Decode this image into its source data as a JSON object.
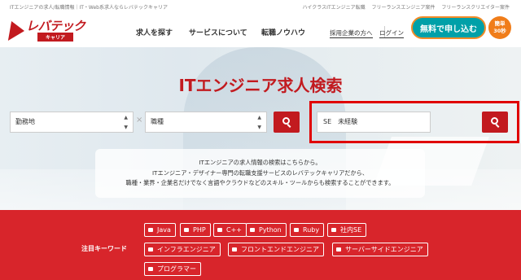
{
  "top_strip": {
    "left_text": "ITエンジニアの求人/転職情報｜IT・Web系求人ならレバテックキャリア",
    "right_links": [
      "ハイクラスITエンジニア転職",
      "フリーランスエンジニア案件",
      "フリーランスクリエイター案件"
    ]
  },
  "header": {
    "logo_brand": "レバテック",
    "logo_sub": "キャリア",
    "nav": [
      "求人を探す",
      "サービスについて",
      "転職ノウハウ"
    ],
    "employer_link": "採用企業の方へ",
    "login_link": "ログイン",
    "cta_label": "無料で申し込む",
    "badge_line1": "簡単",
    "badge_line2": "30秒"
  },
  "hero": {
    "title": "ITエンジニア求人検索",
    "location_select": "勤務地",
    "job_select": "職種",
    "separator": "×",
    "keyword_value": "SE　未経験",
    "info_lines": [
      "ITエンジニアの求人情報の検索はこちらから。",
      "ITエンジニア・デザイナー専門の転職支援サービスのレバテックキャリアだから、",
      "職種・業界・企業名だけでなく言語やクラウドなどのスキル・ツールからも検索することができます。"
    ]
  },
  "keywords": {
    "label": "注目キーワード",
    "items": [
      "Java",
      "PHP",
      "C++",
      "Python",
      "Ruby",
      "社内SE",
      "インフラエンジニア",
      "フロントエンドエンジニア",
      "サーバーサイドエンジニア",
      "プログラマー"
    ]
  },
  "colors": {
    "brand_red": "#c21a1f",
    "band_red": "#d8252b",
    "cta_teal": "#00a0a8",
    "badge_orange": "#f07d1a",
    "highlight": "#e00000"
  }
}
